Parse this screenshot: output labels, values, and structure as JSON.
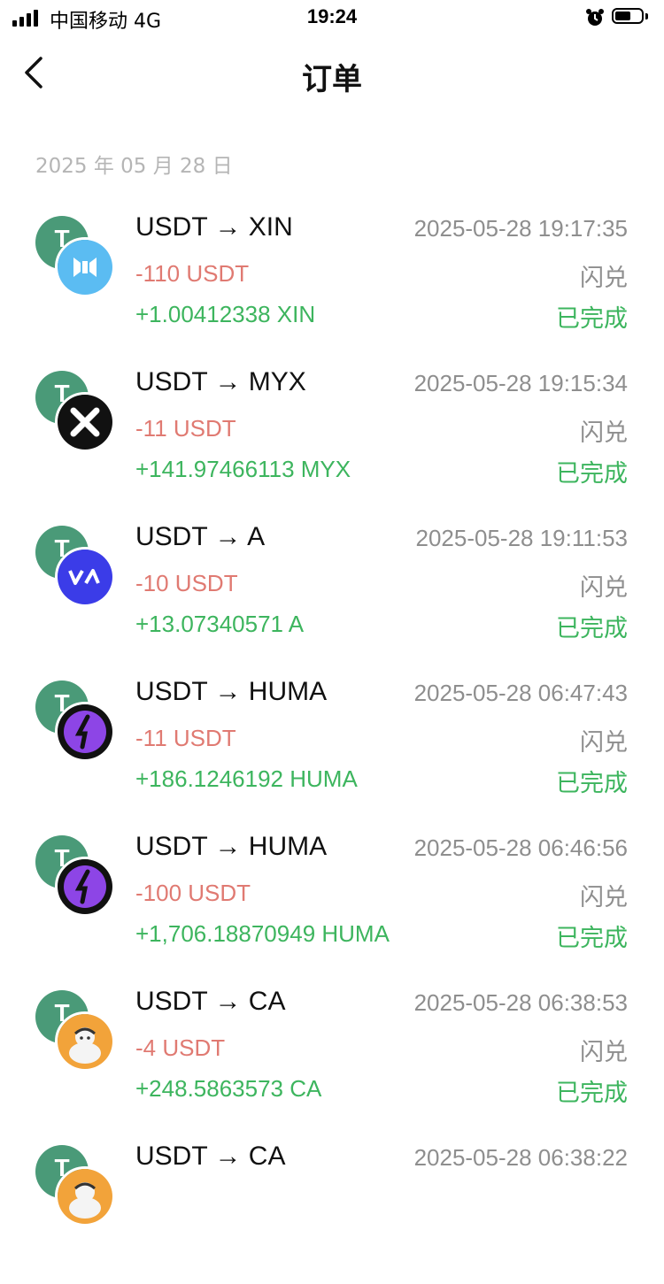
{
  "status_bar": {
    "carrier": "中国移动  4G",
    "time": "19:24",
    "battery_level": 0.6
  },
  "nav": {
    "title": "订单"
  },
  "date_header": "2025 年 05 月 28 日",
  "orders": [
    {
      "pair": "USDT → XIN",
      "time": "2025-05-28 19:17:35",
      "debit": "-110 USDT",
      "kind": "闪兑",
      "credit": "+1.00412338 XIN",
      "status": "已完成",
      "icon": "xin-icon",
      "icon_color": "#5bbcf2"
    },
    {
      "pair": "USDT → MYX",
      "time": "2025-05-28 19:15:34",
      "debit": "-11 USDT",
      "kind": "闪兑",
      "credit": "+141.97466113 MYX",
      "status": "已完成",
      "icon": "myx-icon",
      "icon_color": "#111111"
    },
    {
      "pair": "USDT → A",
      "time": "2025-05-28 19:11:53",
      "debit": "-10 USDT",
      "kind": "闪兑",
      "credit": "+13.07340571 A",
      "status": "已完成",
      "icon": "a-icon",
      "icon_color": "#3b3ce8"
    },
    {
      "pair": "USDT → HUMA",
      "time": "2025-05-28 06:47:43",
      "debit": "-11 USDT",
      "kind": "闪兑",
      "credit": "+186.1246192 HUMA",
      "status": "已完成",
      "icon": "huma-icon",
      "icon_color": "#8d45e6"
    },
    {
      "pair": "USDT → HUMA",
      "time": "2025-05-28 06:46:56",
      "debit": "-100 USDT",
      "kind": "闪兑",
      "credit": "+1,706.18870949 HUMA",
      "status": "已完成",
      "icon": "huma-icon",
      "icon_color": "#8d45e6"
    },
    {
      "pair": "USDT → CA",
      "time": "2025-05-28 06:38:53",
      "debit": "-4 USDT",
      "kind": "闪兑",
      "credit": "+248.5863573 CA",
      "status": "已完成",
      "icon": "ca-icon",
      "icon_color": "#f2a33a"
    },
    {
      "pair": "USDT → CA",
      "time": "2025-05-28 06:38:22",
      "debit": "",
      "kind": "",
      "credit": "",
      "status": "",
      "icon": "ca-icon",
      "icon_color": "#f2a33a"
    }
  ]
}
